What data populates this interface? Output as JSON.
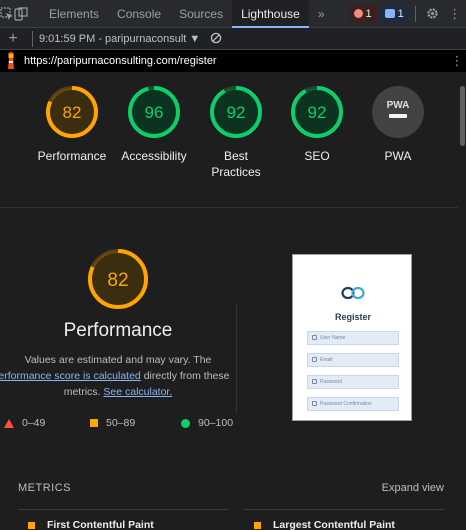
{
  "devtools": {
    "tabs": [
      "Elements",
      "Console",
      "Sources",
      "Lighthouse"
    ],
    "active_tab": "Lighthouse",
    "more_label": "»",
    "errors_count": "1",
    "messages_count": "1"
  },
  "session": {
    "plus_label": "+",
    "report_label": "9:01:59 PM - paripurnaconsult ▼"
  },
  "url": {
    "text": "https://paripurnaconsulting.com/register"
  },
  "gauges": [
    {
      "score": 82,
      "label": "Performance",
      "color": "#ffa400"
    },
    {
      "score": 96,
      "label": "Accessibility",
      "color": "#0cce6b"
    },
    {
      "score": 92,
      "label": "Best Practices",
      "color": "#0cce6b"
    },
    {
      "score": 92,
      "label": "SEO",
      "color": "#0cce6b"
    }
  ],
  "pwa": {
    "label": "PWA",
    "badge": "PWA"
  },
  "performance": {
    "score": 82,
    "title": "Performance",
    "text_1": "Values are estimated and may vary. The",
    "link_1": "performance score is calculated",
    "text_2": "directly from these",
    "text_3": "metrics.",
    "link_2": "See calculator."
  },
  "legend": {
    "fail": "0–49",
    "average": "50–89",
    "pass": "90–100"
  },
  "thumbnail": {
    "title": "Register",
    "fields": [
      "User Name",
      "Email",
      "Password",
      "Password Confirmation"
    ]
  },
  "metrics": {
    "title": "METRICS",
    "expand_label": "Expand view",
    "items": [
      "First Contentful Paint",
      "Largest Contentful Paint"
    ]
  },
  "colors": {
    "orange": "#ffa400",
    "green": "#0cce6b",
    "red": "#ff4e42"
  }
}
